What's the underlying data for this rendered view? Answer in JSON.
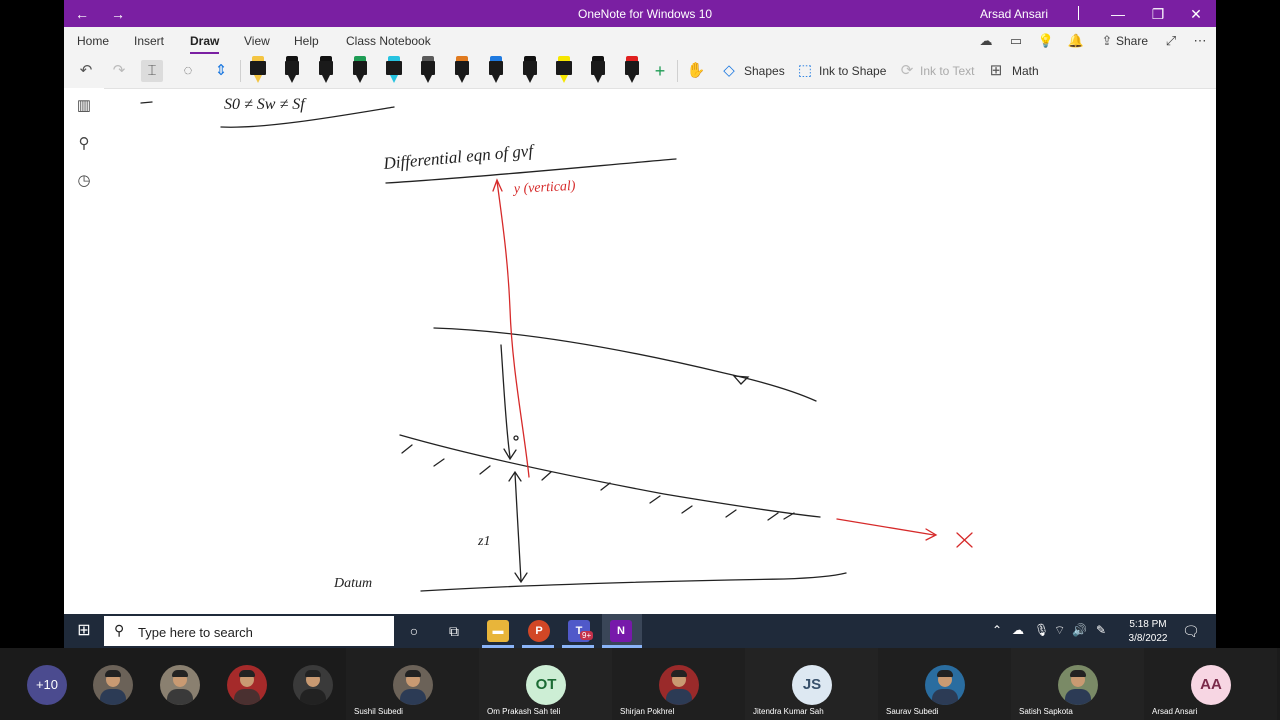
{
  "window": {
    "title": "OneNote for Windows 10",
    "user": "Arsad  Ansari",
    "back_glyph": "←",
    "forward_glyph": "→",
    "min_glyph": "—",
    "restore_glyph": "❐",
    "close_glyph": "✕",
    "title_color": "#7a1fa2"
  },
  "menu": {
    "items": [
      {
        "label": "Home"
      },
      {
        "label": "Insert"
      },
      {
        "label": "Draw",
        "active": true
      },
      {
        "label": "View"
      },
      {
        "label": "Help"
      },
      {
        "label": "Class Notebook"
      }
    ],
    "share_label": "Share",
    "icons": [
      "sync-icon",
      "page-icon",
      "lightbulb-icon",
      "bell-icon",
      "share-icon",
      "expand-icon",
      "more-icon"
    ],
    "more_glyph": "⋯"
  },
  "toolbar": {
    "tools": [
      "undo-icon",
      "redo-icon",
      "select-text-icon",
      "lasso-icon",
      "space-icon"
    ],
    "pens": [
      {
        "cap": "#f4c542",
        "type": "highlighter"
      },
      {
        "cap": "#111111",
        "type": "pen"
      },
      {
        "cap": "#111111",
        "type": "pen"
      },
      {
        "cap": "#1f9d55",
        "type": "pen"
      },
      {
        "cap": "#27c3e0",
        "type": "highlighter"
      },
      {
        "cap": "#5a5a5a",
        "type": "pen"
      },
      {
        "cap": "#e07a1f",
        "type": "pen"
      },
      {
        "cap": "#1f7ae0",
        "type": "pen"
      },
      {
        "cap": "#111111",
        "type": "pen"
      },
      {
        "cap": "#f6e600",
        "type": "highlighter"
      },
      {
        "cap": "#111111",
        "type": "pen"
      },
      {
        "cap": "#e0201f",
        "type": "pen"
      }
    ],
    "add_glyph": "+",
    "shapes_label": "Shapes",
    "ink_to_shape_label": "Ink to Shape",
    "ink_to_text_label": "Ink to Text",
    "math_label": "Math"
  },
  "left_nav": {
    "icons": [
      "notebooks-icon",
      "search-icon",
      "recent-icon"
    ]
  },
  "taskbar": {
    "search_placeholder": "Type here to search",
    "time": "5:18 PM",
    "date": "3/8/2022",
    "apps": [
      "cortana-icon",
      "task-view-icon",
      "file-explorer-icon",
      "powerpoint-icon",
      "teams-icon",
      "onenote-icon"
    ],
    "teams_badge": "9+"
  },
  "meeting": {
    "overflow_label": "+10",
    "participants": [
      {
        "name": "Sushil Subedi",
        "type": "photo",
        "bg": "#6b6258"
      },
      {
        "name": "Om Prakash Sah teli",
        "type": "initials",
        "initials": "OT",
        "bg": "#cdeed5",
        "fg": "#1b6b34"
      },
      {
        "name": "Shirjan Pokhrel",
        "type": "photo",
        "bg": "#9a2a2a"
      },
      {
        "name": "Jitendra Kumar Sah",
        "type": "initials",
        "initials": "JS",
        "bg": "#dde8f2",
        "fg": "#37506b"
      },
      {
        "name": "Saurav Subedi",
        "type": "photo",
        "bg": "#2a6da0"
      },
      {
        "name": "Satish Sapkota",
        "type": "photo",
        "bg": "#7a8a66"
      },
      {
        "name": "Arsad  Ansari",
        "type": "initials",
        "initials": "AA",
        "bg": "#f7d6e3",
        "fg": "#7a2a4a"
      }
    ]
  },
  "ink": {
    "title": "Differential eqn of  gvf",
    "y_label": "y (vertical)",
    "z_label": "z1",
    "datum_label": "Datum",
    "x_label": "X",
    "top_partial": "S0  ≠  Sw  ≠  Sf"
  }
}
